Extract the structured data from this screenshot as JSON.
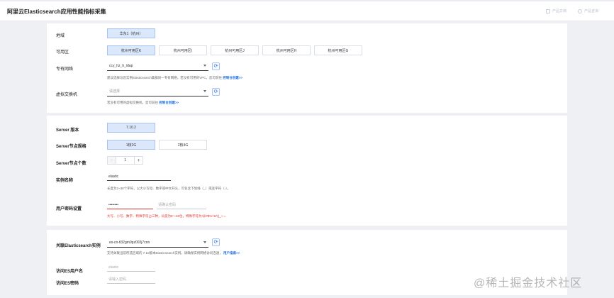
{
  "header": {
    "title": "阿里云Elasticsearch应用性能指标采集",
    "link_docs": "产品文档",
    "link_help": "产品咨询"
  },
  "network": {
    "region_label": "地域",
    "region_value": "华东1（杭州）",
    "zone_label": "可用区",
    "zones": [
      "杭州可用区K",
      "杭州可用区I",
      "杭州可用区J",
      "杭州可用区H",
      "杭州可用区G"
    ],
    "vpc_label": "专有网络",
    "vpc_value": "ccy_hz_h_idap",
    "vpc_hint": "建议选择与您实例Elasticsearch集群同一专有网络，若没有可用的VPC，您可前往",
    "vpc_hint_link": "控制台创建>>",
    "vswitch_label": "虚拟交换机",
    "vswitch_placeholder": "请选择",
    "vswitch_hint": "若没有可用的虚拟交换机，您可前往",
    "vswitch_hint_link": "控制台创建>>"
  },
  "server": {
    "version_label": "Server 版本",
    "version_value": "7.10.2",
    "spec_label": "Server节点规格",
    "specs": [
      "1核2G",
      "2核4G"
    ],
    "count_label": "Server节点个数",
    "count_minus": "−",
    "count_value": "1",
    "count_plus": "+",
    "name_label": "实例名称",
    "name_value": "elastic",
    "name_hint": "长度为2~30个字符，以大小写母、数字或中文开头，可包含下划线（_）或连字符（-）。",
    "pwd_label": "用户密码设置",
    "pwd_value": "••••••••",
    "pwd_confirm_placeholder": "请确认密码",
    "pwd_error": "大写、小写、数字、特殊字符占三种，长度为8～32位，特殊字符为!@#$%^&*()_+-="
  },
  "es": {
    "instance_label": "关联Elasticsearch实例",
    "instance_value": "es-cn-tl32gm0pz002j7cnn",
    "instance_hint": "支持关联当前所选区域的 7.10版本Elasticsearch实例，请确保实例网络访问连通，",
    "instance_hint_link": "用户指南>>",
    "user_label": "访问ES用户名",
    "user_value": "elastic",
    "pwd_label": "访问ES密码",
    "pwd_placeholder": "请输入密码"
  },
  "watermark": "@稀土掘金技术社区"
}
